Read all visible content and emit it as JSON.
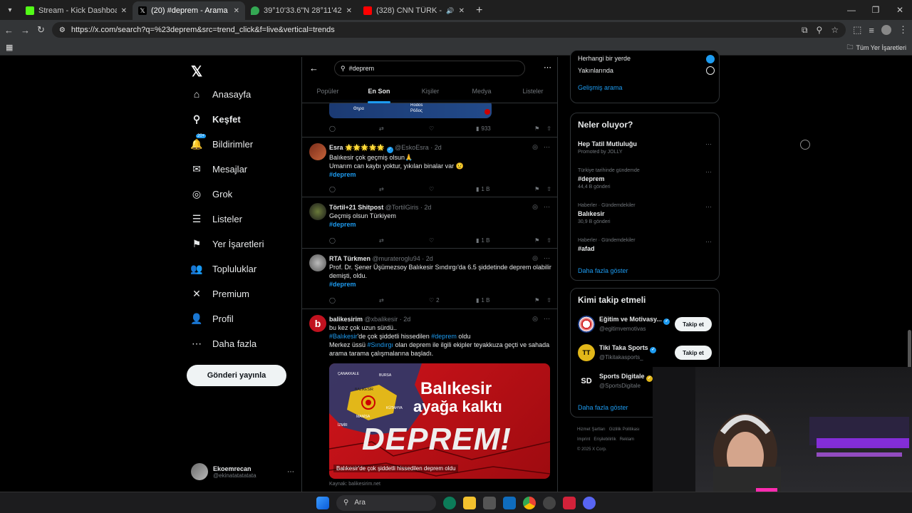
{
  "browser": {
    "tabs": [
      {
        "title": "Stream - Kick Dashboard",
        "color": "#53fc18"
      },
      {
        "title": "(20) #deprem - Arama / X",
        "color": "#ffffff"
      },
      {
        "title": "39°10'33.6\"N 28°11'42.7\"E - Go",
        "color": "#34a853"
      },
      {
        "title": "(328) CNN TÜRK - ● Canlı",
        "color": "#ff0000"
      }
    ],
    "url": "https://x.com/search?q=%23deprem&src=trend_click&f=live&vertical=trends",
    "bookmarks_label": "Tüm Yer İşaretleri"
  },
  "nav": {
    "items": [
      {
        "label": "Anasayfa",
        "icon": "home-icon",
        "glyph": "⌂"
      },
      {
        "label": "Keşfet",
        "icon": "search-icon",
        "glyph": "⚲"
      },
      {
        "label": "Bildirimler",
        "icon": "bell-icon",
        "glyph": "🔔"
      },
      {
        "label": "Mesajlar",
        "icon": "mail-icon",
        "glyph": "✉"
      },
      {
        "label": "Grok",
        "icon": "grok-icon",
        "glyph": "◎"
      },
      {
        "label": "Listeler",
        "icon": "list-icon",
        "glyph": "☰"
      },
      {
        "label": "Yer İşaretleri",
        "icon": "bookmark-icon",
        "glyph": "⚑"
      },
      {
        "label": "Topluluklar",
        "icon": "communities-icon",
        "glyph": "👥"
      },
      {
        "label": "Premium",
        "icon": "x-icon",
        "glyph": "✕"
      },
      {
        "label": "Profil",
        "icon": "profile-icon",
        "glyph": "👤"
      },
      {
        "label": "Daha fazla",
        "icon": "more-circle-icon",
        "glyph": "⋯"
      }
    ],
    "badge": "20+",
    "post_button": "Gönderi yayınla",
    "account": {
      "name": "Ekoemrecan",
      "handle": "@ekinatatatatata"
    }
  },
  "search": {
    "query": "#deprem",
    "tabs": [
      "Popüler",
      "En Son",
      "Kişiler",
      "Medya",
      "Listeler"
    ]
  },
  "map_labels": [
    "Θηρα",
    "Rodos",
    "Ρόδος"
  ],
  "tweets": [
    {
      "name": "Esra 🌟🌟🌟🌟🌟",
      "handle": "@EskoEsra",
      "time": "2d",
      "lines": [
        "Balıkesir çok geçmiş olsun🙏",
        "Umarım can kaybı yoktur, yıkılan binalar var 😟"
      ],
      "hashtag": "#deprem",
      "views": "1 B",
      "likes": ""
    },
    {
      "name": "Törtil+21 Shitpost",
      "handle": "@TortilGiris",
      "time": "2d",
      "lines": [
        "Geçmiş olsun Türkiyem"
      ],
      "hashtag": "#deprem",
      "views": "1 B",
      "likes": ""
    },
    {
      "name": "RTA Türkmen",
      "handle": "@murateroglu94",
      "time": "2d",
      "lines": [
        "Prof. Dr. Şener Üşümezsoy Balıkesir Sındırgı'da 6.5 şiddetinde deprem olabilir",
        "demişti, oldu."
      ],
      "hashtag": "#deprem",
      "views": "1 B",
      "likes": "2"
    },
    {
      "name": "balikesirim",
      "handle": "@xbalikesir",
      "time": "2d",
      "line1": "bu kez çok uzun sürdü..",
      "line2a": "#Balıkesir",
      "line2b": "'de çok şiddetli hissedilen ",
      "line2c": "#deprem",
      "line2d": " oldu",
      "line3a": "Merkez üssü ",
      "line3b": "#Sındırgı",
      "line3c": " olan deprem ile ilgili ekipler  teyakkuza geçti ve sahada",
      "line4": "arama tarama çalışmalarına başladı."
    }
  ],
  "top_tweet": {
    "views": "933"
  },
  "image": {
    "title1": "Balıkesir",
    "title2": "ayağa kalktı",
    "big": "DEPREM!",
    "caption": "Balıkesir'de çok şiddetli hissedilen deprem oldu",
    "source": "Kaynak: balikesirim.net",
    "map_labels": [
      "ÇANAKKALE",
      "BURSA",
      "BALIKESİR",
      "MANİSA",
      "KÜTAHYA",
      "İZMİR"
    ]
  },
  "right": {
    "location_opts": [
      "Herhangi bir yerde",
      "Yakınlarında"
    ],
    "advanced": "Gelişmiş arama",
    "whats_happening": "Neler oluyor?",
    "trends": [
      {
        "context": "",
        "name": "Hep Tatil Mutluluğu",
        "count": "Promoted by JOLLY"
      },
      {
        "context": "Türkiye tarihinde gündemde",
        "name": "#deprem",
        "count": "44,4 B gönderi"
      },
      {
        "context": "Haberler · Gündemdekiler",
        "name": "Balıkesir",
        "count": "30,9 B gönderi"
      },
      {
        "context": "Haberler · Gündemdekiler",
        "name": "#afad",
        "count": ""
      }
    ],
    "show_more": "Daha fazla göster",
    "who_to_follow": "Kimi takip etmeli",
    "follow": [
      {
        "name": "Eğitim ve Motivasy...",
        "handle": "@egitimvemotivas",
        "button": "Takip et"
      },
      {
        "name": "Tiki Taka Sports",
        "handle": "@Tikitakasports_",
        "button": "Takip et"
      },
      {
        "name": "Sports Digitale",
        "handle": "@SportsDigitale",
        "button": ""
      }
    ],
    "footer": [
      "Hizmet Şartları",
      "Gizlilik Politikası",
      "Imprint",
      "Erişilebilirlik",
      "Reklam",
      "© 2025 X Corp."
    ]
  },
  "taskbar": {
    "search": "Ara"
  }
}
